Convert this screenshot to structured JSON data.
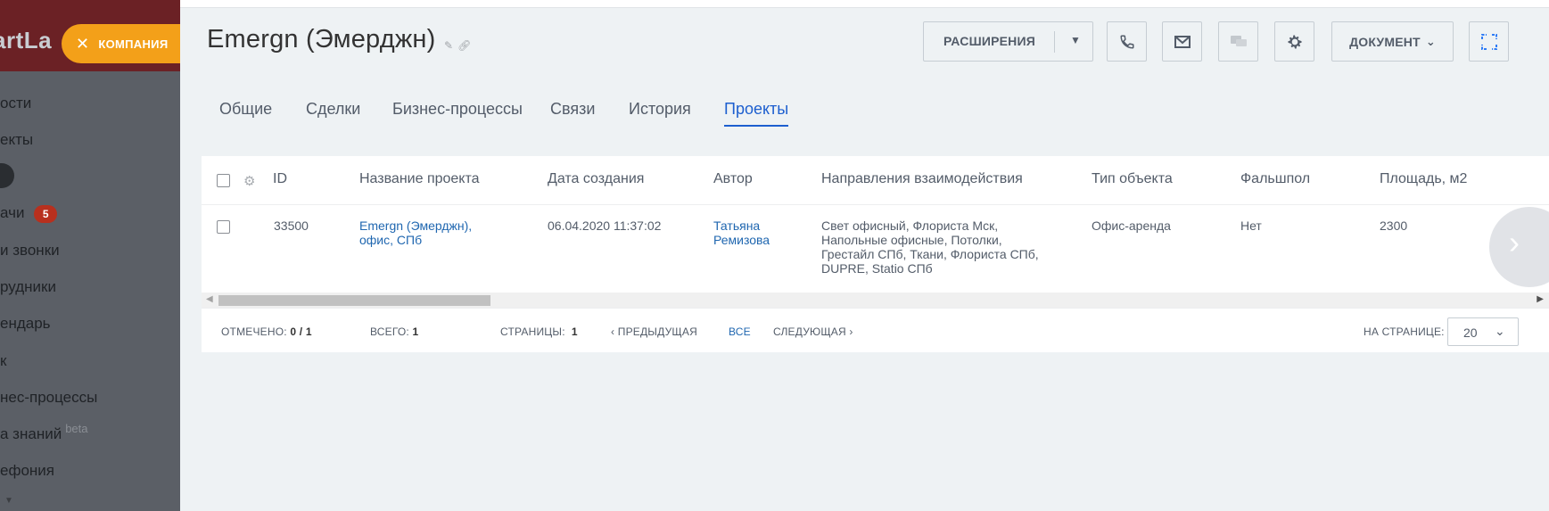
{
  "sidebar": {
    "logo": "artLa",
    "items": [
      {
        "label": "ости"
      },
      {
        "label": "екты"
      },
      {
        "label": "ачи",
        "badge": "5"
      },
      {
        "label": "и звонки"
      },
      {
        "label": "рудники"
      },
      {
        "label": "ендарь"
      },
      {
        "label": "к"
      },
      {
        "label": "нес-процессы"
      },
      {
        "label": "а знаний",
        "beta": "beta"
      },
      {
        "label": "ефония"
      }
    ]
  },
  "company_tab": {
    "label": "КОМПАНИЯ"
  },
  "header": {
    "title": "Emergn  (Эмерджн)",
    "buttons": {
      "extensions": "РАСШИРЕНИЯ",
      "document": "ДОКУМЕНТ"
    }
  },
  "tabs": [
    {
      "label": "Общие"
    },
    {
      "label": "Сделки"
    },
    {
      "label": "Бизнес-процессы"
    },
    {
      "label": "Связи"
    },
    {
      "label": "История"
    },
    {
      "label": "Проекты",
      "active": true
    }
  ],
  "grid": {
    "columns": [
      "ID",
      "Название проекта",
      "Дата создания",
      "Автор",
      "Направления взаимодействия",
      "Тип объекта",
      "Фальшпол",
      "Площадь, м2"
    ],
    "rows": [
      {
        "id": "33500",
        "name_line1": "Emergn (Эмерджн),",
        "name_line2": "офис, СПб",
        "created": "06.04.2020 11:37:02",
        "author_line1": "Татьяна",
        "author_line2": "Ремизова",
        "directions": [
          "Свет офисный, Флориста Мск,",
          "Напольные офисные, Потолки,",
          "Грестайл СПб, Ткани, Флориста СПб,",
          "DUPRE, Statio СПб"
        ],
        "object_type": "Офис-аренда",
        "raised_floor": "Нет",
        "area": "2300"
      }
    ]
  },
  "footer": {
    "marked_label": "ОТМЕЧЕНО:",
    "marked_value": "0 / 1",
    "total_label": "ВСЕГО:",
    "total_value": "1",
    "pages_label": "СТРАНИЦЫ:",
    "pages_value": "1",
    "prev": "ПРЕДЫДУЩАЯ",
    "all": "ВСЕ",
    "next": "СЛЕДУЮЩАЯ",
    "per_page_label": "НА СТРАНИЦЕ:",
    "per_page_value": "20"
  }
}
